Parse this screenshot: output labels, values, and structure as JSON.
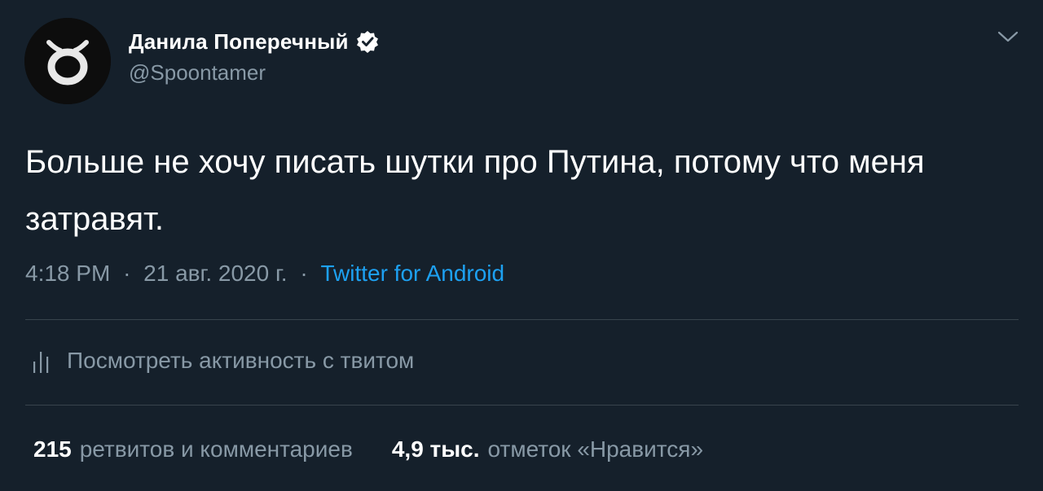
{
  "author": {
    "name": "Данила Поперечный",
    "handle": "@Spoontamer",
    "verified": true
  },
  "tweet": {
    "text": "Больше не хочу писать шутки про Путина, потому что меня затравят.",
    "time": "4:18 PM",
    "date": "21 авг. 2020 г.",
    "separator": "·",
    "source": "Twitter for Android"
  },
  "activity": {
    "label": "Посмотреть активность с твитом",
    "icon": "analytics-icon"
  },
  "stats": {
    "retweets_count": "215",
    "retweets_label": "ретвитов и комментариев",
    "likes_count": "4,9 тыс.",
    "likes_label": "отметок «Нравится»"
  },
  "colors": {
    "background": "#15202b",
    "text": "#ffffff",
    "secondary": "#8899a6",
    "accent": "#1da1f2",
    "divider": "#38444d"
  }
}
